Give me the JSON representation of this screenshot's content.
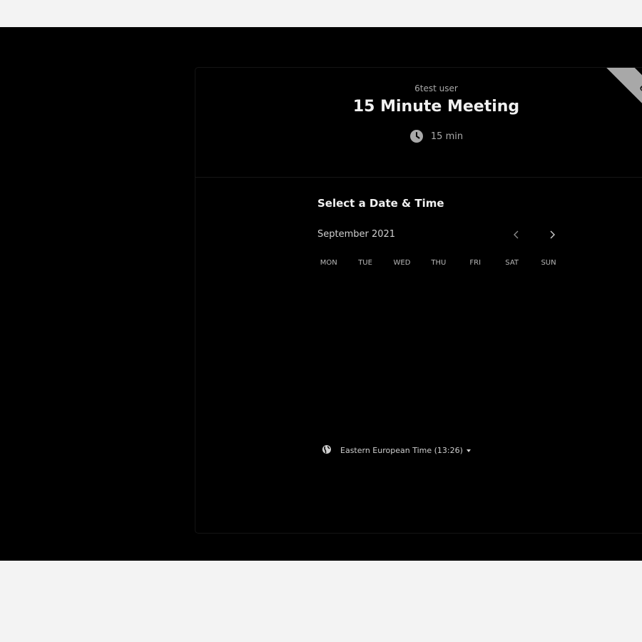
{
  "event": {
    "host_name": "6test user",
    "title": "15 Minute Meeting",
    "duration": "15 min"
  },
  "badge": {
    "label": "Ca"
  },
  "calendar": {
    "section_title": "Select a Date & Time",
    "month_label": "September 2021",
    "weekdays": [
      "MON",
      "TUE",
      "WED",
      "THU",
      "FRI",
      "SAT",
      "SUN"
    ],
    "prev_icon": "chevron-left-icon",
    "next_icon": "chevron-right-icon"
  },
  "timezone": {
    "label": "Eastern European Time (13:26)",
    "icon": "globe-icon"
  },
  "colors": {
    "background": "#000000",
    "page_margin": "#f3f3f3",
    "text_primary": "#f0f0f0",
    "text_secondary": "#a9a9a9",
    "badge": "#a8a8a8"
  }
}
